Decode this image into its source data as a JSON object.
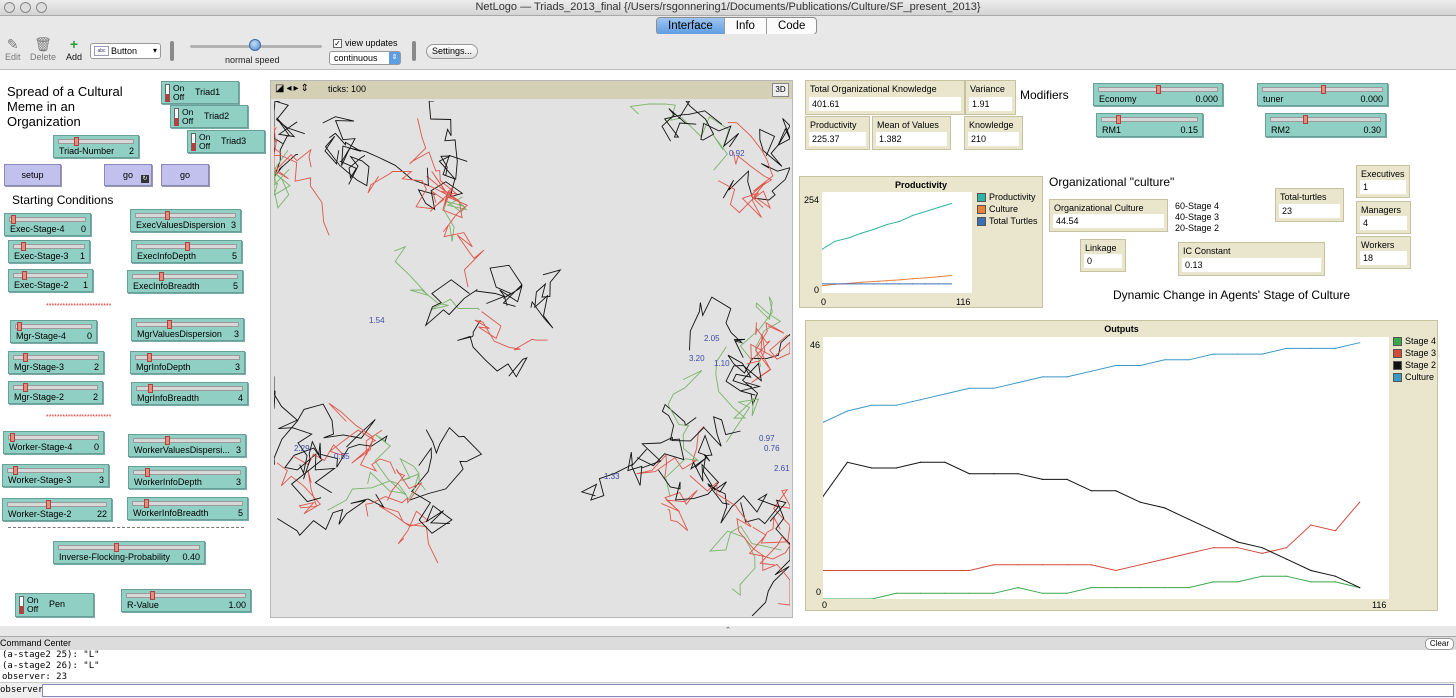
{
  "window": {
    "title": "NetLogo — Triads_2013_final {/Users/rsgonnering1/Documents/Publications/Culture/SF_present_2013}"
  },
  "tabs": [
    "Interface",
    "Info",
    "Code"
  ],
  "toolbar": {
    "edit": "Edit",
    "delete": "Delete",
    "add": "Add",
    "widget_type": "Button",
    "speed_label": "normal speed",
    "view_updates_label": "view updates",
    "view_updates_checked": true,
    "update_mode": "continuous",
    "settings": "Settings..."
  },
  "left": {
    "title_lines": [
      "Spread of a  Cultural",
      "Meme in an",
      "Organization"
    ],
    "switches": {
      "triad1": "Triad1",
      "triad2": "Triad2",
      "triad3": "Triad3",
      "pen": "Pen",
      "on": "On",
      "off": "Off"
    },
    "triad_number": {
      "name": "Triad-Number",
      "value": "2",
      "level": 0.2
    },
    "buttons": {
      "setup": "setup",
      "go_forever": "go",
      "go_once": "go"
    },
    "starting_conditions": "Starting Conditions",
    "separator": "************************",
    "sliders": [
      {
        "name": "Exec-Stage-4",
        "value": "0",
        "level": 0.0
      },
      {
        "name": "Exec-Stage-3",
        "value": "1",
        "level": 0.1
      },
      {
        "name": "Exec-Stage-2",
        "value": "1",
        "level": 0.1
      },
      {
        "name": "ExecValuesDispersion",
        "value": "3",
        "level": 0.3
      },
      {
        "name": "ExecInfoDepth",
        "value": "5",
        "level": 0.5
      },
      {
        "name": "ExecInfoBreadth",
        "value": "5",
        "level": 0.25
      },
      {
        "name": "Mgr-Stage-4",
        "value": "0",
        "level": 0.0
      },
      {
        "name": "Mgr-Stage-3",
        "value": "2",
        "level": 0.1
      },
      {
        "name": "Mgr-Stage-2",
        "value": "2",
        "level": 0.1
      },
      {
        "name": "MgrValuesDispersion",
        "value": "3",
        "level": 0.3
      },
      {
        "name": "MgrInfoDepth",
        "value": "3",
        "level": 0.1
      },
      {
        "name": "MgrInfoBreadth",
        "value": "4",
        "level": 0.1
      },
      {
        "name": "Worker-Stage-4",
        "value": "0",
        "level": 0.0
      },
      {
        "name": "Worker-Stage-3",
        "value": "3",
        "level": 0.05
      },
      {
        "name": "Worker-Stage-2",
        "value": "22",
        "level": 0.4
      },
      {
        "name": "WorkerValuesDispersi...",
        "value": "3",
        "level": 0.3
      },
      {
        "name": "WorkerInfoDepth",
        "value": "3",
        "level": 0.1
      },
      {
        "name": "WorkerInfoBreadth",
        "value": "5",
        "level": 0.1
      }
    ],
    "inverse_flocking": {
      "name": "Inverse-Flocking-Probability",
      "value": "0.40",
      "level": 0.4
    },
    "r_value": {
      "name": "R-Value",
      "value": "1.00",
      "level": 0.2
    }
  },
  "view": {
    "ticks_label": "ticks: 100",
    "btn_3d": "3D",
    "agent_labels": [
      "1.54",
      "2.05",
      "2.29",
      "0.76",
      "1.33",
      "3.20",
      "0.92",
      "2.61",
      "0.97",
      "1.10",
      "0.85"
    ]
  },
  "monitors": {
    "total_knowledge": {
      "name": "Total Organizational Knowledge",
      "value": "401.61"
    },
    "variance": {
      "name": "Variance",
      "value": "1.91"
    },
    "productivity": {
      "name": "Productivity",
      "value": "225.37"
    },
    "mean_values": {
      "name": "Mean of Values",
      "value": "1.382"
    },
    "knowledge": {
      "name": "Knowledge",
      "value": "210"
    },
    "org_culture": {
      "name": "Organizational Culture",
      "value": "44.54"
    },
    "linkage": {
      "name": "Linkage",
      "value": "0"
    },
    "ic_constant": {
      "name": "IC Constant",
      "value": "0.13"
    },
    "total_turtles": {
      "name": "Total-turtles",
      "value": "23"
    },
    "executives": {
      "name": "Executives",
      "value": "1"
    },
    "managers": {
      "name": "Managers",
      "value": "4"
    },
    "workers": {
      "name": "Workers",
      "value": "18"
    }
  },
  "right": {
    "modifiers": "Modifiers",
    "org_culture_title": "Organizational \"culture\"",
    "stage_key": [
      "60-Stage 4",
      "40-Stage 3",
      "20-Stage 2"
    ],
    "dynamic_title": "Dynamic Change in Agents' Stage of Culture",
    "sliders": {
      "economy": {
        "name": "Economy",
        "value": "0.000",
        "level": 0.5
      },
      "tuner": {
        "name": "tuner",
        "value": "0.000",
        "level": 0.5
      },
      "rm1": {
        "name": "RM1",
        "value": "0.15",
        "level": 0.15
      },
      "rm2": {
        "name": "RM2",
        "value": "0.30",
        "level": 0.3
      }
    }
  },
  "plots": {
    "productivity": {
      "title": "Productivity",
      "ymax": "254",
      "ymin": "0",
      "xmin": "0",
      "xmax": "116",
      "legend": [
        {
          "name": "Productivity",
          "color": "#2fb5a5"
        },
        {
          "name": "Culture",
          "color": "#e8823a"
        },
        {
          "name": "Total Turtles",
          "color": "#3d6fb5"
        }
      ]
    },
    "outputs": {
      "title": "Outputs",
      "ymax": "46",
      "ymin": "0",
      "xmin": "0",
      "xmax": "116",
      "legend": [
        {
          "name": "Stage 4",
          "color": "#3aa84a"
        },
        {
          "name": "Stage 3",
          "color": "#d24b3c"
        },
        {
          "name": "Stage 2",
          "color": "#111111"
        },
        {
          "name": "Culture",
          "color": "#3a98c5"
        }
      ]
    }
  },
  "chart_data": [
    {
      "type": "line",
      "title": "Productivity",
      "xlim": [
        0,
        116
      ],
      "ylim": [
        0,
        254
      ],
      "x": [
        0,
        10,
        20,
        30,
        40,
        50,
        60,
        70,
        80,
        90,
        100
      ],
      "series": [
        {
          "name": "Productivity",
          "values": [
            110,
            130,
            138,
            150,
            160,
            172,
            180,
            195,
            205,
            215,
            225
          ]
        },
        {
          "name": "Culture",
          "values": [
            18,
            22,
            24,
            27,
            29,
            31,
            33,
            36,
            38,
            41,
            44
          ]
        },
        {
          "name": "Total Turtles",
          "values": [
            23,
            23,
            23,
            23,
            23,
            23,
            23,
            23,
            23,
            23,
            23
          ]
        }
      ]
    },
    {
      "type": "line",
      "title": "Outputs",
      "xlim": [
        0,
        116
      ],
      "ylim": [
        0,
        46
      ],
      "x": [
        0,
        5,
        10,
        15,
        20,
        25,
        30,
        35,
        40,
        45,
        50,
        55,
        60,
        65,
        70,
        75,
        80,
        85,
        90,
        95,
        100,
        105,
        110
      ],
      "series": [
        {
          "name": "Stage 4",
          "values": [
            0,
            0,
            0,
            1,
            1,
            1,
            1,
            1,
            2,
            1,
            1,
            2,
            2,
            2,
            2,
            2,
            3,
            3,
            4,
            4,
            3,
            3,
            2
          ]
        },
        {
          "name": "Stage 3",
          "values": [
            5,
            5,
            5,
            5,
            5,
            5,
            5,
            6,
            6,
            6,
            6,
            6,
            5,
            6,
            7,
            8,
            9,
            9,
            8,
            9,
            13,
            12,
            17
          ]
        },
        {
          "name": "Stage 2",
          "values": [
            18,
            24,
            23,
            23,
            24,
            24,
            22,
            22,
            22,
            21,
            21,
            19,
            19,
            17,
            16,
            14,
            12,
            10,
            9,
            7,
            5,
            4,
            2
          ]
        },
        {
          "name": "Culture",
          "values": [
            31,
            33,
            34,
            34,
            35,
            36,
            37,
            37,
            38,
            39,
            39,
            40,
            41,
            41,
            42,
            42,
            43,
            43,
            43,
            44,
            44,
            44,
            45
          ]
        }
      ]
    }
  ],
  "command_center": {
    "title": "Command Center",
    "clear": "Clear",
    "lines": [
      "(a-stage2 25): \"L\"",
      "(a-stage2 26): \"L\"",
      "observer: 23"
    ],
    "prompt": "observer>"
  }
}
